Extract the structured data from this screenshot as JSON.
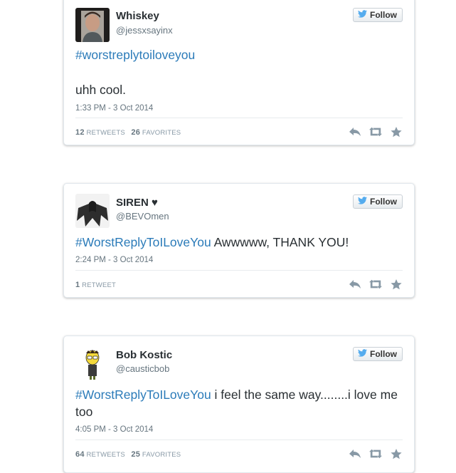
{
  "tweets": [
    {
      "name": "Whiskey",
      "handle": "@jessxsayinx",
      "follow_label": "Follow",
      "hashtag": "#worstreplytoiloveyou",
      "text_rest": "",
      "second_line": "uhh cool.",
      "time": "1:33 PM - 3 Oct 2014",
      "retweets_count": "12",
      "retweets_label": "RETWEETS",
      "favorites_count": "26",
      "favorites_label": "FAVORITES"
    },
    {
      "name": "SIREN ♥",
      "handle": "@BEVOmen",
      "follow_label": "Follow",
      "hashtag": "#WorstReplyToILoveYou",
      "text_rest": " Awwwww, THANK YOU!",
      "time": "2:24 PM - 3 Oct 2014",
      "retweets_count": "1",
      "retweets_label": "RETWEET",
      "favorites_count": "",
      "favorites_label": ""
    },
    {
      "name": "Bob Kostic",
      "handle": "@causticbob",
      "follow_label": "Follow",
      "hashtag": "#WorstReplyToILoveYou",
      "text_rest": " i feel the same way........i love me too",
      "time": "4:05 PM - 3 Oct 2014",
      "retweets_count": "64",
      "retweets_label": "RETWEETS",
      "favorites_count": "25",
      "favorites_label": "FAVORITES"
    }
  ],
  "icons": {
    "follow": "twitter-bird-icon",
    "reply": "reply-icon",
    "retweet": "retweet-icon",
    "favorite": "star-icon"
  },
  "colors": {
    "link": "#2b7bb9",
    "bird": "#55acee",
    "muted": "#66757f",
    "icon": "#8899a6"
  }
}
